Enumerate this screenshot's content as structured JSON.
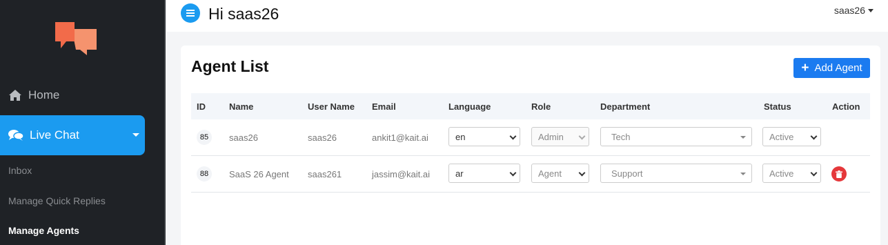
{
  "sidebar": {
    "home_label": "Home",
    "live_chat_label": "Live Chat",
    "sub_items": [
      {
        "label": "Inbox"
      },
      {
        "label": "Manage Quick Replies"
      },
      {
        "label": "Manage Agents"
      }
    ]
  },
  "topbar": {
    "greeting": "Hi saas26",
    "user": "saas26"
  },
  "page": {
    "title": "Agent List",
    "add_button": "Add Agent"
  },
  "table": {
    "headers": [
      "ID",
      "Name",
      "User Name",
      "Email",
      "Language",
      "Role",
      "Department",
      "Status",
      "Action"
    ],
    "rows": [
      {
        "id": "85",
        "name": "saas26",
        "username": "saas26",
        "email": "ankit1@kait.ai",
        "language": "en",
        "role": "Admin",
        "department": "Tech",
        "status": "Active"
      },
      {
        "id": "88",
        "name": "SaaS 26 Agent",
        "username": "saas261",
        "email": "jassim@kait.ai",
        "language": "ar",
        "role": "Agent",
        "department": "Support",
        "status": "Active"
      }
    ]
  },
  "colors": {
    "sidebar_bg": "#1f2226",
    "accent": "#1b9bf0",
    "button": "#1b7bf0",
    "danger": "#e5383b",
    "logo_dark": "#f26b4a",
    "logo_light": "#f5936e"
  }
}
